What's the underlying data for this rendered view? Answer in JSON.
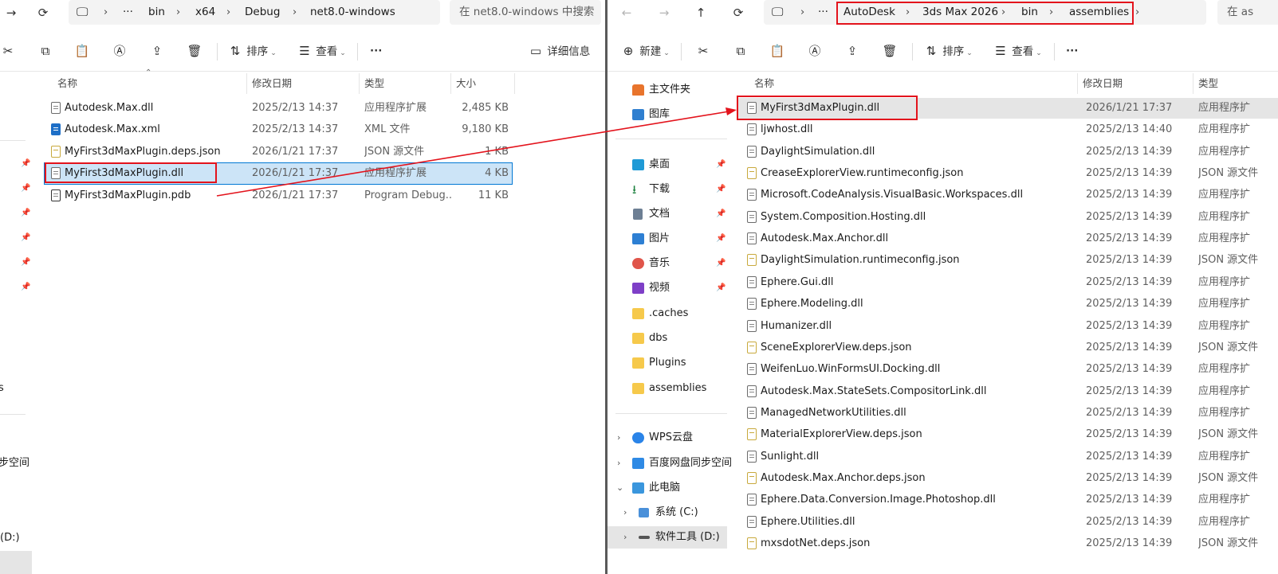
{
  "left": {
    "breadcrumb": [
      "bin",
      "x64",
      "Debug",
      "net8.0-windows"
    ],
    "search_placeholder": "在 net8.0-windows 中搜索",
    "toolbar": {
      "sort": "排序",
      "view": "查看",
      "more": "···",
      "details": "详细信息"
    },
    "columns": {
      "name": "名称",
      "date": "修改日期",
      "type": "类型",
      "size": "大小"
    },
    "files": [
      {
        "name": "Autodesk.Max.dll",
        "date": "2025/2/13 14:37",
        "type": "应用程序扩展",
        "size": "2,485 KB",
        "icon": "dll"
      },
      {
        "name": "Autodesk.Max.xml",
        "date": "2025/2/13 14:37",
        "type": "XML 文件",
        "size": "9,180 KB",
        "icon": "xml"
      },
      {
        "name": "MyFirst3dMaxPlugin.deps.json",
        "date": "2026/1/21 17:37",
        "type": "JSON 源文件",
        "size": "1 KB",
        "icon": "json"
      },
      {
        "name": "MyFirst3dMaxPlugin.dll",
        "date": "2026/1/21 17:37",
        "type": "应用程序扩展",
        "size": "4 KB",
        "icon": "dll",
        "selected": true
      },
      {
        "name": "MyFirst3dMaxPlugin.pdb",
        "date": "2026/1/21 17:37",
        "type": "Program Debug...",
        "size": "11 KB",
        "icon": "pdb"
      }
    ],
    "sidebar_fragments": {
      "item_s": "s",
      "sync_space": "步空间",
      "drive_d": "(D:)"
    }
  },
  "right": {
    "breadcrumb": [
      "AutoDesk",
      "3ds Max 2026",
      "bin",
      "assemblies"
    ],
    "search_fragment": "在 as",
    "toolbar": {
      "new": "新建",
      "sort": "排序",
      "view": "查看",
      "more": "···"
    },
    "columns": {
      "name": "名称",
      "date": "修改日期",
      "type": "类型"
    },
    "sidebar": {
      "home": "主文件夹",
      "gallery": "图库",
      "desktop": "桌面",
      "downloads": "下载",
      "documents": "文档",
      "pictures": "图片",
      "music": "音乐",
      "videos": "视频",
      "caches": ".caches",
      "dbs": "dbs",
      "plugins": "Plugins",
      "assemblies": "assemblies",
      "wps": "WPS云盘",
      "baidu": "百度网盘同步空间",
      "this_pc": "此电脑",
      "system_c": "系统 (C:)",
      "tools_d": "软件工具 (D:)"
    },
    "files": [
      {
        "name": "MyFirst3dMaxPlugin.dll",
        "date": "2026/1/21 17:37",
        "type": "应用程序扩",
        "icon": "dll",
        "selected": true
      },
      {
        "name": "ljwhost.dll",
        "date": "2025/2/13 14:40",
        "type": "应用程序扩",
        "icon": "dll"
      },
      {
        "name": "DaylightSimulation.dll",
        "date": "2025/2/13 14:39",
        "type": "应用程序扩",
        "icon": "dll"
      },
      {
        "name": "CreaseExplorerView.runtimeconfig.json",
        "date": "2025/2/13 14:39",
        "type": "JSON 源文件",
        "icon": "json"
      },
      {
        "name": "Microsoft.CodeAnalysis.VisualBasic.Workspaces.dll",
        "date": "2025/2/13 14:39",
        "type": "应用程序扩",
        "icon": "dll"
      },
      {
        "name": "System.Composition.Hosting.dll",
        "date": "2025/2/13 14:39",
        "type": "应用程序扩",
        "icon": "dll"
      },
      {
        "name": "Autodesk.Max.Anchor.dll",
        "date": "2025/2/13 14:39",
        "type": "应用程序扩",
        "icon": "dll"
      },
      {
        "name": "DaylightSimulation.runtimeconfig.json",
        "date": "2025/2/13 14:39",
        "type": "JSON 源文件",
        "icon": "json"
      },
      {
        "name": "Ephere.Gui.dll",
        "date": "2025/2/13 14:39",
        "type": "应用程序扩",
        "icon": "dll"
      },
      {
        "name": "Ephere.Modeling.dll",
        "date": "2025/2/13 14:39",
        "type": "应用程序扩",
        "icon": "dll"
      },
      {
        "name": "Humanizer.dll",
        "date": "2025/2/13 14:39",
        "type": "应用程序扩",
        "icon": "dll"
      },
      {
        "name": "SceneExplorerView.deps.json",
        "date": "2025/2/13 14:39",
        "type": "JSON 源文件",
        "icon": "json"
      },
      {
        "name": "WeifenLuo.WinFormsUI.Docking.dll",
        "date": "2025/2/13 14:39",
        "type": "应用程序扩",
        "icon": "dll"
      },
      {
        "name": "Autodesk.Max.StateSets.CompositorLink.dll",
        "date": "2025/2/13 14:39",
        "type": "应用程序扩",
        "icon": "dll"
      },
      {
        "name": "ManagedNetworkUtilities.dll",
        "date": "2025/2/13 14:39",
        "type": "应用程序扩",
        "icon": "dll"
      },
      {
        "name": "MaterialExplorerView.deps.json",
        "date": "2025/2/13 14:39",
        "type": "JSON 源文件",
        "icon": "json"
      },
      {
        "name": "Sunlight.dll",
        "date": "2025/2/13 14:39",
        "type": "应用程序扩",
        "icon": "dll"
      },
      {
        "name": "Autodesk.Max.Anchor.deps.json",
        "date": "2025/2/13 14:39",
        "type": "JSON 源文件",
        "icon": "json"
      },
      {
        "name": "Ephere.Data.Conversion.Image.Photoshop.dll",
        "date": "2025/2/13 14:39",
        "type": "应用程序扩",
        "icon": "dll"
      },
      {
        "name": "Ephere.Utilities.dll",
        "date": "2025/2/13 14:39",
        "type": "应用程序扩",
        "icon": "dll"
      },
      {
        "name": "mxsdotNet.deps.json",
        "date": "2025/2/13 14:39",
        "type": "JSON 源文件",
        "icon": "json"
      }
    ]
  },
  "colors": {
    "annotation_red": "#e3131c",
    "selection_blue": "#cce4f7",
    "selection_border": "#0078d4"
  }
}
